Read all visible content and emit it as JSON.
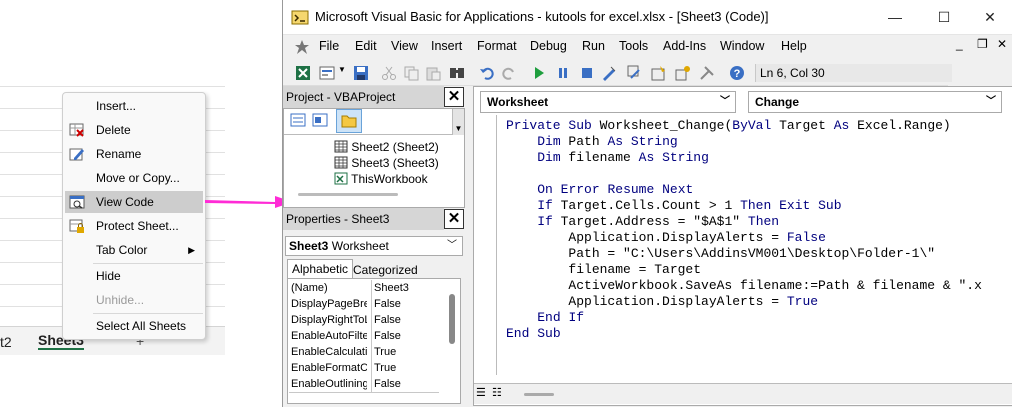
{
  "excel": {
    "sheet_tabs": [
      "t2",
      "Sheet3",
      "+"
    ]
  },
  "context_menu": {
    "items": [
      {
        "label": "Insert...",
        "icon": "none"
      },
      {
        "label": "Delete",
        "icon": "delete-sheet-icon"
      },
      {
        "label": "Rename",
        "icon": "rename-icon"
      },
      {
        "label": "Move or Copy...",
        "icon": "none"
      },
      {
        "label": "View Code",
        "icon": "view-code-icon",
        "highlighted": true
      },
      {
        "label": "Protect Sheet...",
        "icon": "protect-sheet-icon"
      },
      {
        "label": "Tab Color",
        "icon": "none",
        "submenu": true
      },
      {
        "label": "Hide",
        "icon": "none"
      },
      {
        "label": "Unhide...",
        "icon": "none",
        "disabled": true
      },
      {
        "label": "Select All Sheets",
        "icon": "none"
      }
    ]
  },
  "vba": {
    "title": "Microsoft Visual Basic for Applications - kutools for excel.xlsx - [Sheet3 (Code)]",
    "window_controls": [
      "—",
      "☐",
      "✕"
    ],
    "inner_controls": [
      "_",
      "❐",
      "✕"
    ],
    "menu": [
      "File",
      "Edit",
      "View",
      "Insert",
      "Format",
      "Debug",
      "Run",
      "Tools",
      "Add-Ins",
      "Window",
      "Help"
    ],
    "status": "Ln 6, Col 30",
    "project_panel": {
      "title": "Project - VBAProject",
      "items": [
        "Sheet2 (Sheet2)",
        "Sheet3 (Sheet3)",
        "ThisWorkbook"
      ]
    },
    "properties_panel": {
      "title": "Properties - Sheet3",
      "object_name": "Sheet3",
      "object_type": "Worksheet",
      "tabs": [
        "Alphabetic",
        "Categorized"
      ],
      "rows": [
        {
          "key": "(Name)",
          "value": "Sheet3"
        },
        {
          "key": "DisplayPageBrea",
          "value": "False"
        },
        {
          "key": "DisplayRightToL",
          "value": "False"
        },
        {
          "key": "EnableAutoFilter",
          "value": "False"
        },
        {
          "key": "EnableCalculatio",
          "value": "True"
        },
        {
          "key": "EnableFormatCo",
          "value": "True"
        },
        {
          "key": "EnableOutlining",
          "value": "False"
        }
      ]
    },
    "code": {
      "object": "Worksheet",
      "procedure": "Change",
      "lines": [
        "Private Sub Worksheet_Change(ByVal Target As Excel.Range)",
        "    Dim Path As String",
        "    Dim filename As String",
        "",
        "    On Error Resume Next",
        "    If Target.Cells.Count > 1 Then Exit Sub",
        "    If Target.Address = \"$A$1\" Then",
        "        Application.DisplayAlerts = False",
        "        Path = \"C:\\Users\\AddinsVM001\\Desktop\\Folder-1\\\"",
        "        filename = Target",
        "        ActiveWorkbook.SaveAs filename:=Path & filename & \".x",
        "        Application.DisplayAlerts = True",
        "    End If",
        "End Sub"
      ]
    }
  },
  "colors": {
    "arrow": "#ff2bd6",
    "keyword": "#00007f",
    "highlight": "#cdcdcd"
  }
}
